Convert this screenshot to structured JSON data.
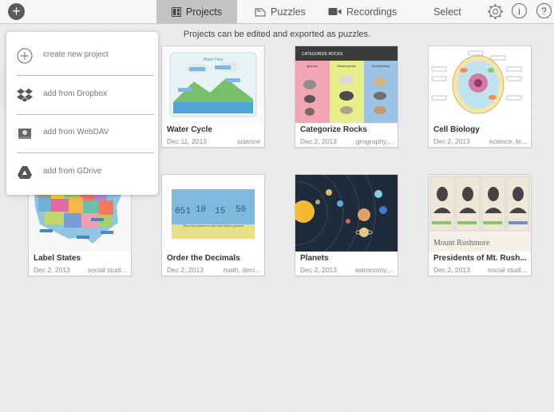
{
  "toolbar": {
    "add_button": "+",
    "tabs": [
      {
        "label": "Projects",
        "icon": "grid-icon",
        "active": true
      },
      {
        "label": "Puzzles",
        "icon": "puzzle-icon",
        "active": false
      },
      {
        "label": "Recordings",
        "icon": "video-camera-icon",
        "active": false
      }
    ],
    "select_label": "Select",
    "info_label": "i",
    "help_label": "?"
  },
  "hint": "Projects can be edited and exported as puzzles.",
  "menu": {
    "items": [
      {
        "label": "create new project",
        "icon": "plus-circle-icon"
      },
      {
        "label": "add from Dropbox",
        "icon": "dropbox-icon"
      },
      {
        "label": "add from WebDAV",
        "icon": "drive-icon"
      },
      {
        "label": "add from GDrive",
        "icon": "gdrive-icon"
      }
    ]
  },
  "projects": [
    {
      "title": "Water Cycle",
      "date": "Dec 11, 2013",
      "tags": "science"
    },
    {
      "title": "Categorize Rocks",
      "date": "Dec 2, 2013",
      "tags": "grography,..."
    },
    {
      "title": "Cell Biology",
      "date": "Dec 2, 2013",
      "tags": "science, bi..."
    },
    {
      "title": "Label States",
      "date": "Dec 2, 2013",
      "tags": "social studi..."
    },
    {
      "title": "Order the Decimals",
      "date": "Dec 2, 2013",
      "tags": "math, deci..."
    },
    {
      "title": "Planets",
      "date": "Dec 2, 2013",
      "tags": "astronomy,..."
    },
    {
      "title": "Presidents of Mt. Rush...",
      "date": "Dec 2, 2013",
      "tags": "social studi..."
    }
  ],
  "thumbs": {
    "water_cycle_heading": "Water Flow",
    "rocks_heading": "CATEGORIZE ROCKS",
    "rocks_columns": [
      "Igneous",
      "Metamorphic",
      "Sedimentary"
    ],
    "decimals": [
      "051",
      "10",
      "15",
      "50"
    ],
    "decimals_caption": "Place the numbers in order from least to greatest",
    "rushmore_caption": "Mount Rushmore"
  },
  "colors": {
    "accent_active_tab": "#c3c3c3",
    "rocks_header": "#3b3b3b",
    "planets_bg": "#1e2b3b"
  }
}
